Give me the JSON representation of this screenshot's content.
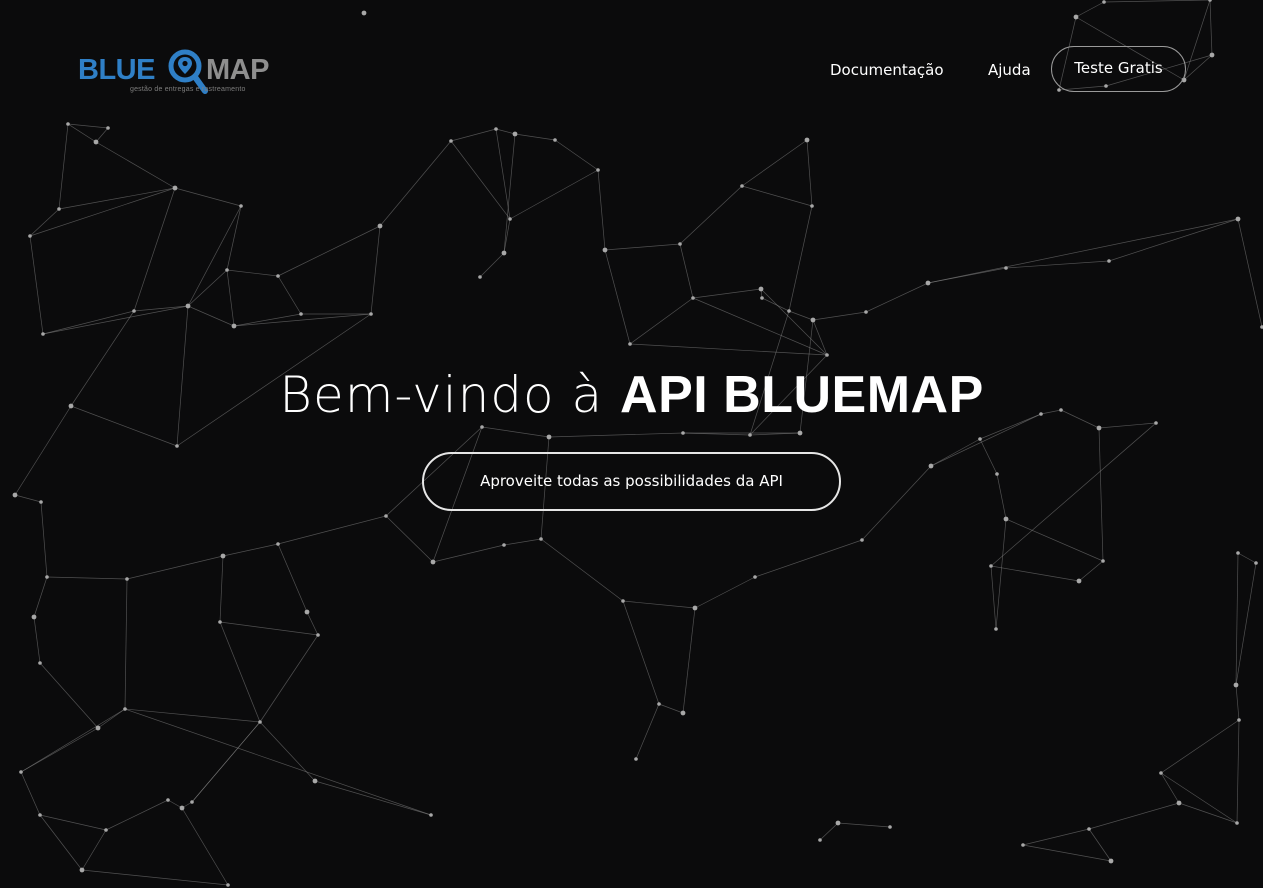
{
  "brand": {
    "name_part1": "BLUE",
    "name_part2": "MAP",
    "tagline": "gestão de entregas e rastreamento",
    "primary_color": "#2f7fc6",
    "secondary_color": "#8e8e8e",
    "icon": "map-search-pin-icon"
  },
  "nav": {
    "links": [
      {
        "label": "Documentação"
      },
      {
        "label": "Ajuda"
      }
    ],
    "cta_label": "Teste Gratis"
  },
  "hero": {
    "title_light": "Bem-vindo à ",
    "title_bold": "API BLUEMAP",
    "button_label": "Aproveite todas as possibilidades da API"
  },
  "theme": {
    "background": "#0b0b0c",
    "text": "#ffffff",
    "network_color": "#8a8a8a"
  }
}
